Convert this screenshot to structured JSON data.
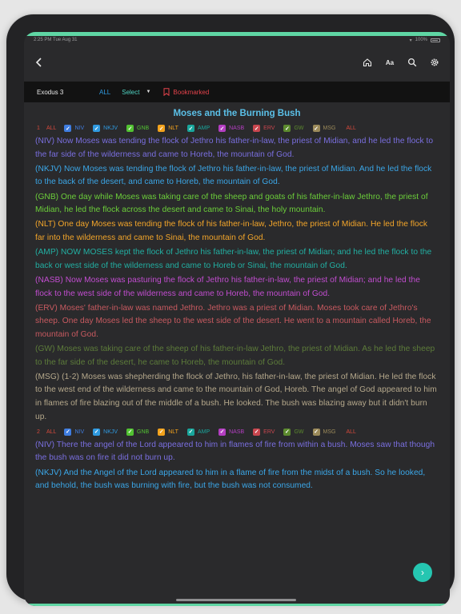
{
  "status": {
    "time": "2:25 PM",
    "date": "Tue Aug 31",
    "battery": "100%"
  },
  "toolbar": {
    "book": "Exodus 3",
    "all": "ALL",
    "select": "Select",
    "bookmarked": "Bookmarked"
  },
  "chapter_title": "Moses and the Burning Bush",
  "filters": {
    "all_left": "ALL",
    "all_right": "ALL",
    "versions": [
      {
        "label": "NIV",
        "color": "#3f7de0"
      },
      {
        "label": "NKJV",
        "color": "#2f9ae0"
      },
      {
        "label": "GNB",
        "color": "#52c232"
      },
      {
        "label": "NLT",
        "color": "#f2a21c"
      },
      {
        "label": "AMP",
        "color": "#19a69c"
      },
      {
        "label": "NASB",
        "color": "#b43ec2"
      },
      {
        "label": "ERV",
        "color": "#c8464e"
      },
      {
        "label": "GW",
        "color": "#5c8a2e"
      },
      {
        "label": "MSG",
        "color": "#9b8a5a"
      }
    ]
  },
  "verses": [
    {
      "number": "1",
      "texts": [
        {
          "text": "(NIV) Now Moses was tending the flock of Jethro his father-in-law, the priest of Midian, and he led the flock to the far side of the wilderness and came to Horeb, the mountain of God.",
          "color": "#7a6fe0"
        },
        {
          "text": "(NKJV) Now Moses was tending the flock of Jethro his father-in-law, the priest of Midian. And he led the flock to the back of the desert, and came to Horeb, the mountain of God.",
          "color": "#3ba7e8"
        },
        {
          "text": "(GNB) One day while Moses was taking care of the sheep and goats of his father-in-law Jethro, the priest of Midian, he led the flock across the desert and came to Sinai, the holy mountain.",
          "color": "#6ccf3a"
        },
        {
          "text": "(NLT) One day Moses was tending the flock of his father-in-law, Jethro, the priest of Midian. He led the flock far into the wilderness and came to Sinai, the mountain of God.",
          "color": "#f4a62a"
        },
        {
          "text": "(AMP) NOW MOSES kept the flock of Jethro his father-in-law, the priest of Midian; and he led the flock to the back or west side of the wilderness and came to Horeb or Sinai, the mountain of God.",
          "color": "#22b0a3"
        },
        {
          "text": "(NASB) Now Moses was pasturing the flock of Jethro his father-in-law, the priest of Midian; and he led the flock to the west side of the wilderness and came to Horeb, the mountain of God.",
          "color": "#c24dd0"
        },
        {
          "text": "(ERV) Moses' father-in-law was named Jethro. Jethro was a priest of Midian. Moses took care of Jethro's sheep. One day Moses led the sheep to the west side of the desert. He went to a mountain called Horeb, the mountain of God.",
          "color": "#c85a60"
        },
        {
          "text": "(GW) Moses was taking care of the sheep of his father-in-law Jethro, the priest of Midian. As he led the sheep to the far side of the desert, he came to Horeb, the mountain of God.",
          "color": "#5d7c3a"
        },
        {
          "text": "(MSG) (1-2) Moses was shepherding the flock of Jethro, his father-in-law, the priest of Midian. He led the flock to the west end of the wilderness and came to the mountain of God, Horeb. The angel of God appeared to him in flames of fire blazing out of the middle of a bush. He looked. The bush was blazing away but it didn't burn up.",
          "color": "#b6a98c"
        }
      ]
    },
    {
      "number": "2",
      "texts": [
        {
          "text": "(NIV) There the angel of the Lord appeared to him in flames of fire from within a bush. Moses saw that though the bush was on fire it did not burn up.",
          "color": "#7a6fe0"
        },
        {
          "text": "(NKJV) And the Angel of the Lord appeared to him in a flame of fire from the midst of a bush. So he looked, and behold, the bush was burning with fire, but the bush was not consumed.",
          "color": "#3ba7e8"
        }
      ]
    }
  ]
}
